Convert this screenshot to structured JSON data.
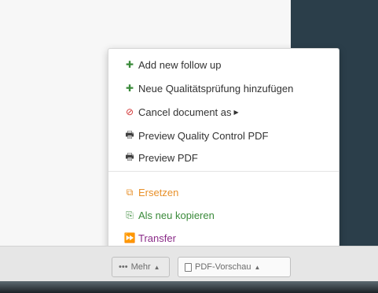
{
  "menu": {
    "items": [
      {
        "label": "Add new follow up",
        "icon": "plus-icon",
        "color": "#3a8a3a"
      },
      {
        "label": "Neue Qualitätsprüfung hinzufügen",
        "icon": "plus-icon",
        "color": "#3a8a3a"
      },
      {
        "label": "Cancel document as",
        "icon": "ban-icon",
        "color": "#d23232"
      },
      {
        "label": "Preview Quality Control PDF",
        "icon": "printer-icon",
        "color": "#404040"
      },
      {
        "label": "Preview PDF",
        "icon": "printer-icon",
        "color": "#404040"
      },
      {
        "label": "Ersetzen",
        "icon": "replace-icon",
        "color": "#e8902a"
      },
      {
        "label": "Als neu kopieren",
        "icon": "copy-icon",
        "color": "#3a8a3a"
      },
      {
        "label": "Transfer",
        "icon": "fast-forward-icon",
        "color": "#8a2b88"
      }
    ]
  },
  "footer": {
    "mehr_label": "Mehr",
    "pdf_label": "PDF-Vorschau"
  },
  "colors": {
    "sidebar_dark": "#2b3e4a",
    "accent_orange": "#e8902a",
    "accent_purple": "#8a2b88"
  }
}
